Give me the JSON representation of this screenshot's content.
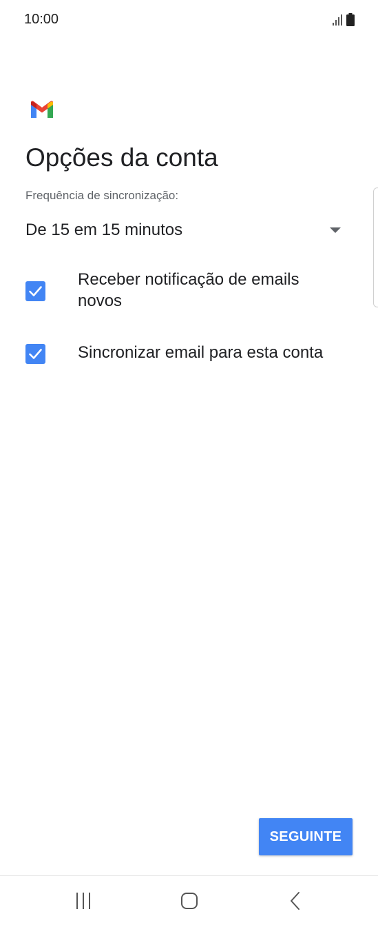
{
  "status_bar": {
    "time": "10:00",
    "icons": [
      "signal-icon",
      "battery-icon"
    ]
  },
  "app": {
    "logo": "gmail-logo",
    "colors": {
      "accent": "#4285f4",
      "gmail_red": "#ea4335",
      "gmail_yellow": "#fbbc04",
      "gmail_green": "#34a853",
      "gmail_blue": "#4285f4"
    }
  },
  "page": {
    "title": "Opções da conta",
    "sync_frequency": {
      "label": "Frequência de sincronização:",
      "value": "De 15 em 15 minutos"
    },
    "options": [
      {
        "label": "Receber notificação de emails novos",
        "checked": true
      },
      {
        "label": "Sincronizar email para esta conta",
        "checked": true
      }
    ],
    "next_button_label": "SEGUINTE"
  },
  "nav_bar": {
    "buttons": [
      "recent-apps-icon",
      "home-icon",
      "back-icon"
    ]
  }
}
